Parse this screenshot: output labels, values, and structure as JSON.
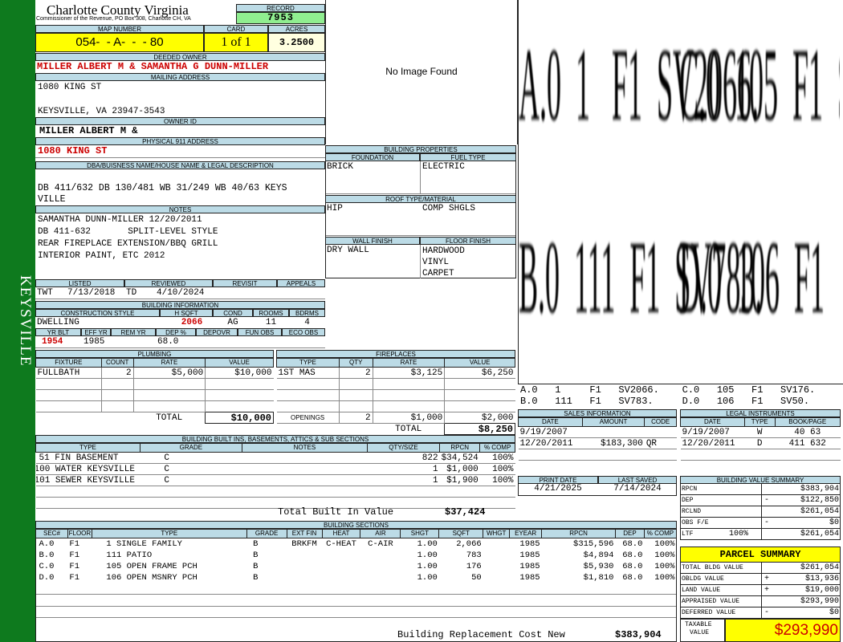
{
  "side_label": "KEYSVILLE",
  "header": {
    "county": "Charlotte County Virginia",
    "address": "Commissioner of the Revenue, PO Box 308, Charlotte CH, VA",
    "record_label": "RECORD",
    "record": "7953",
    "map_label": "MAP NUMBER",
    "map": "054-  - A-  -  - 80",
    "card_label": "CARD",
    "card": "1 of 1",
    "acres_label": "ACRES",
    "acres": "3.2500"
  },
  "owner": {
    "deeded_label": "DEEDED OWNER",
    "deeded": "MILLER ALBERT M & SAMANTHA G DUNN-MILLER",
    "mailing_label": "MAILING ADDRESS",
    "mailing1": "1080 KING ST",
    "mailing2": "KEYSVILLE, VA 23947-3543",
    "id_label": "OWNER ID",
    "id": "MILLER ALBERT M &",
    "physical_label": "PHYSICAL 911 ADDRESS",
    "physical": "1080 KING ST"
  },
  "legal": {
    "label": "DBA/BUISNESS NAME/HOUSE NAME & LEGAL DESCRIPTION",
    "line1": "DB 411/632 DB 130/481 WB 31/249 WB 40/63 KEYS",
    "line2": "VILLE"
  },
  "notes": {
    "label": "NOTES",
    "lines": [
      "SAMANTHA DUNN-MILLER 12/20/2011",
      "DB 411-632       SPLIT-LEVEL STYLE",
      "REAR FIREPLACE EXTENSION/BBQ GRILL",
      "INTERIOR PAINT, ETC 2012"
    ]
  },
  "listing": {
    "listed_label": "LISTED",
    "reviewed_label": "REVIEWED",
    "revisit_label": "REVISIT",
    "appeals_label": "APPEALS",
    "listed_by": "TWT",
    "listed": "7/13/2018",
    "reviewed_by": "TD",
    "reviewed": "4/10/2024"
  },
  "building_info": {
    "label": "BUILDING INFORMATION",
    "style_label": "CONSTRUCTION STYLE",
    "hsqft_label": "H SQFT",
    "cond_label": "COND",
    "rooms_label": "ROOMS",
    "bdrms_label": "BDRMS",
    "style": "DWELLING",
    "hsqft": "2066",
    "cond": "AG",
    "rooms": "11",
    "bdrms": "4",
    "yrblt_label": "YR BLT",
    "effyr_label": "EFF YR",
    "remyr_label": "REM YR",
    "dep_label": "DEP %",
    "depovr_label": "DEPOVR",
    "funobs_label": "FUN OBS",
    "ecoobs_label": "ECO OBS",
    "yrblt": "1954",
    "effyr": "1985",
    "dep": "68.0"
  },
  "image": {
    "no_image": "No Image Found"
  },
  "building_props": {
    "label": "BUILDING PROPERTIES",
    "foundation_label": "FOUNDATION",
    "fuel_label": "FUEL TYPE",
    "foundation": "BRICK",
    "fuel": "ELECTRIC",
    "roof_label": "ROOF TYPE/MATERIAL",
    "roof_type": "HIP",
    "roof_mat": "COMP SHGLS",
    "wall_label": "WALL FINISH",
    "floor_label": "FLOOR FINISH",
    "wall": "DRY WALL",
    "floors": [
      "HARDWOOD",
      "VINYL",
      "CARPET"
    ]
  },
  "sketch": {
    "big": [
      "A.0  1   F1  SV2066.",
      "C.0  105  F1  SV176.",
      "B.0  111  F1  SV783.",
      "D.0  106  F1  SV50."
    ],
    "legend1": "A.0   1     F1   SV2066.    C.0   105   F1   SV176.",
    "legend2": "B.0   111   F1   SV783.     D.0   106   F1   SV50."
  },
  "plumbing": {
    "label": "PLUMBING",
    "cols": [
      "FIXTURE",
      "COUNT",
      "RATE",
      "VALUE"
    ],
    "rows": [
      [
        "FULLBATH",
        "2",
        "$5,000",
        "$10,000"
      ]
    ],
    "total_label": "TOTAL",
    "total": "$10,000"
  },
  "fireplaces": {
    "label": "FIREPLACES",
    "cols": [
      "TYPE",
      "QTY",
      "RATE",
      "VALUE"
    ],
    "rows": [
      [
        "1ST MAS",
        "2",
        "$3,125",
        "$6,250"
      ]
    ],
    "openings_label": "OPENINGS",
    "openings_qty": "2",
    "openings_rate": "$1,000",
    "openings_value": "$2,000",
    "total_label": "TOTAL",
    "total": "$8,250"
  },
  "sales": {
    "label": "SALES INFORMATION",
    "cols": [
      "DATE",
      "AMOUNT",
      "CODE"
    ],
    "rows": [
      [
        "9/19/2007",
        "",
        ""
      ],
      [
        "12/20/2011",
        "$183,300",
        "QR"
      ]
    ]
  },
  "legal_instruments": {
    "label": "LEGAL INSTRUMENTS",
    "cols": [
      "DATE",
      "TYPE",
      "BOOK/PAGE"
    ],
    "rows": [
      [
        "9/19/2007",
        "W",
        "40 63"
      ],
      [
        "12/20/2011",
        "D",
        "411 632"
      ]
    ]
  },
  "dates": {
    "print_label": "PRINT DATE",
    "saved_label": "LAST SAVED",
    "print": "4/21/2025",
    "saved": "7/14/2024"
  },
  "builtins": {
    "label": "BUILDING BUILT INS, BASEMENTS, ATTICS & SUB SECTIONS",
    "cols": [
      "TYPE",
      "GRADE",
      "NOTES",
      "QTY/SIZE",
      "RPCN",
      "% COMP"
    ],
    "rows": [
      [
        "51 FIN BASEMENT",
        "C",
        "",
        "822",
        "$34,524",
        "100%"
      ],
      [
        "100 WATER KEYSVILLE",
        "C",
        "",
        "1",
        "$1,000",
        "100%"
      ],
      [
        "101 SEWER KEYSVILLE",
        "C",
        "",
        "1",
        "$1,900",
        "100%"
      ]
    ],
    "total_label": "Total Built In Value",
    "total": "$37,424"
  },
  "sections": {
    "label": "BUILDING SECTIONS",
    "cols": [
      "SEC#",
      "FLOOR",
      "TYPE",
      "GRADE",
      "EXT FIN",
      "HEAT",
      "AIR",
      "SHGT",
      "SQFT",
      "WHGT",
      "EYEAR",
      "RPCN",
      "DEP",
      "% COMP"
    ],
    "rows": [
      [
        "A.0",
        "F1",
        "1 SINGLE FAMILY",
        "B",
        "BRKFM",
        "C-HEAT",
        "C-AIR",
        "1.00",
        "2,066",
        "",
        "1985",
        "$315,596",
        "68.0",
        "100%"
      ],
      [
        "B.0",
        "F1",
        "111 PATIO",
        "B",
        "",
        "",
        "",
        "1.00",
        "783",
        "",
        "1985",
        "$4,894",
        "68.0",
        "100%"
      ],
      [
        "C.0",
        "F1",
        "105 OPEN FRAME PCH",
        "B",
        "",
        "",
        "",
        "1.00",
        "176",
        "",
        "1985",
        "$5,930",
        "68.0",
        "100%"
      ],
      [
        "D.0",
        "F1",
        "106 OPEN MSNRY PCH",
        "B",
        "",
        "",
        "",
        "1.00",
        "50",
        "",
        "1985",
        "$1,810",
        "68.0",
        "100%"
      ]
    ],
    "replacement_label": "Building Replacement Cost New",
    "replacement": "$383,904"
  },
  "value_summary": {
    "label": "BUILDING VALUE SUMMARY",
    "rows": [
      [
        "RPCN",
        "",
        "",
        "$383,904"
      ],
      [
        "DEP",
        "",
        "-",
        "$122,850"
      ],
      [
        "RCLND",
        "",
        "",
        "$261,054"
      ],
      [
        "OBS F/E",
        "",
        "-",
        "$0"
      ],
      [
        "LTF",
        "100%",
        "",
        "$261,054"
      ]
    ]
  },
  "parcel": {
    "label": "PARCEL SUMMARY",
    "rows": [
      [
        "TOTAL BLDG VALUE",
        "",
        "$261,054"
      ],
      [
        "OBLDG VALUE",
        "+",
        "$13,936"
      ],
      [
        "LAND VALUE",
        "+",
        "$19,000"
      ],
      [
        "APPRAISED VALUE",
        "",
        "$293,990"
      ],
      [
        "DEFERRED VALUE",
        "-",
        "$0"
      ]
    ],
    "taxable_label1": "TAXABLE",
    "taxable_label2": "VALUE",
    "taxable": "$293,990"
  },
  "colors": {
    "sidebar": "#0e7a1e",
    "header_bg": "#bcdbe6",
    "highlight": "#ffff00",
    "record_bg": "#90ee90",
    "red": "#cc0000"
  }
}
